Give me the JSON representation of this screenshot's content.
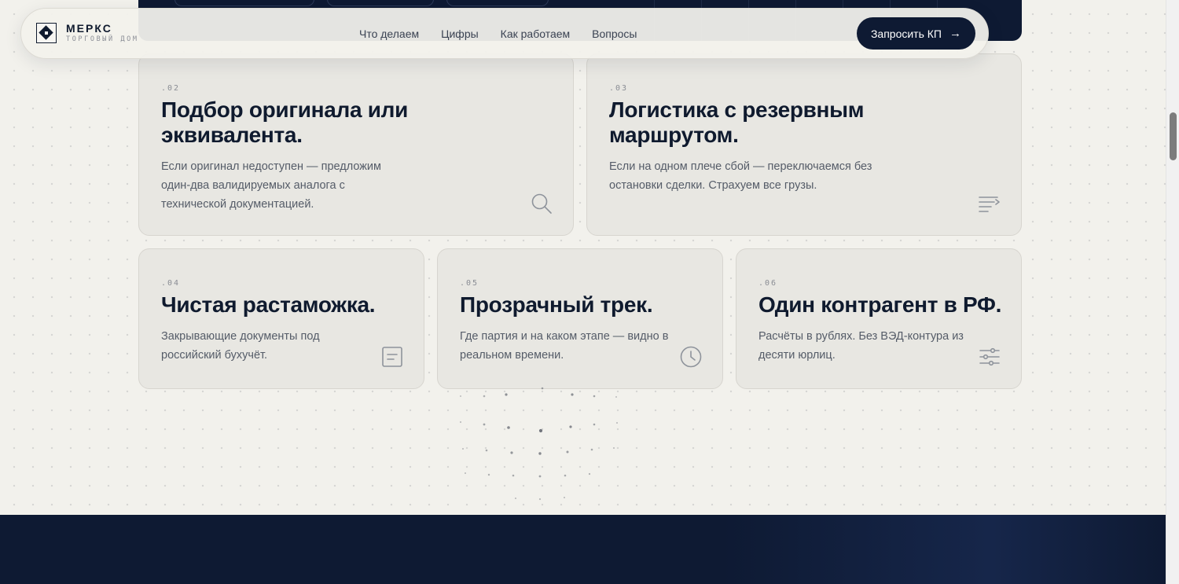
{
  "brand": {
    "name": "МЕРКС",
    "subtitle": "ТОРГОВЫЙ ДОМ"
  },
  "nav": {
    "links": [
      "Что делаем",
      "Цифры",
      "Как работаем",
      "Вопросы"
    ],
    "cta_label": "Запросить КП",
    "cta_arrow": "→"
  },
  "cards": [
    {
      "num": ".02",
      "title": "Подбор оригинала или эквивалента.",
      "desc": "Если оригинал недоступен — предложим один-два валидируемых аналога с технической документацией.",
      "icon": "search-icon"
    },
    {
      "num": ".03",
      "title": "Логистика с резервным маршрутом.",
      "desc": "Если на одном плече сбой — переключаемся без остановки сделки. Страхуем все грузы.",
      "icon": "route-icon"
    },
    {
      "num": ".04",
      "title": "Чистая растаможка.",
      "desc": "Закрывающие документы под российский бухучёт.",
      "icon": "document-icon"
    },
    {
      "num": ".05",
      "title": "Прозрачный трек.",
      "desc": "Где партия и на каком этапе — видно в реальном времени.",
      "icon": "clock-icon"
    },
    {
      "num": ".06",
      "title": "Один контрагент в РФ.",
      "desc": "Расчёты в рублях. Без ВЭД-контура из десяти юрлиц.",
      "icon": "sliders-icon"
    }
  ],
  "colors": {
    "navy": "#0e1a33",
    "card": "#e8e7e2",
    "background": "#f2f1ec",
    "text": "#0f1a2e",
    "muted": "#555c68"
  }
}
